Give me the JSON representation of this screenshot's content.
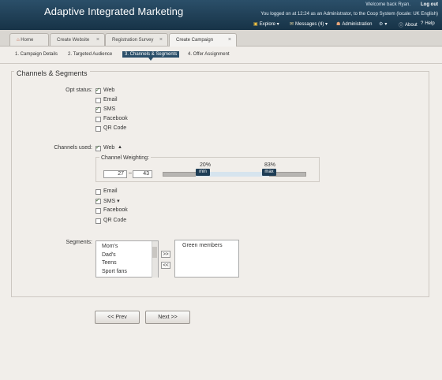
{
  "header": {
    "title": "Adaptive Integrated Marketing",
    "welcome": "Welcome back Ryan.",
    "logout": "Log out",
    "login_info": "You  logged on at 12:24 as an Administrator, to the Coop System (locale: UK English)",
    "menu": {
      "explore": "Explore ▾",
      "messages": "Messages (4) ▾",
      "administration": "Administration",
      "settings": "▾",
      "about": "About",
      "help": "Help"
    }
  },
  "tabs": [
    {
      "label": "Home"
    },
    {
      "label": "Create Website",
      "close": "×"
    },
    {
      "label": "Registration Survey",
      "close": "×"
    },
    {
      "label": "Create Campaign",
      "close": "×"
    }
  ],
  "steps": [
    "1. Campaign Details",
    "2. Targeted Audience",
    "3. Channels & Segments",
    "4. Offer Assignment"
  ],
  "section_title": "Channels & Segments",
  "opt_status": {
    "label": "Opt status:",
    "options": [
      {
        "label": "Web",
        "checked": true
      },
      {
        "label": "Email",
        "checked": false
      },
      {
        "label": "SMS",
        "checked": true
      },
      {
        "label": "Facebook",
        "checked": false
      },
      {
        "label": "QR Code",
        "checked": false
      }
    ]
  },
  "channels_used": {
    "label": "Channels used:",
    "web": {
      "label": "Web",
      "checked": true,
      "toggle": "▲"
    },
    "weighting": {
      "title": "Channel Weighting:",
      "min_value": "27",
      "max_value": "43",
      "separator": "–",
      "min_pct": "20%",
      "max_pct": "83%",
      "min_handle": "min",
      "max_handle": "max"
    },
    "others": [
      {
        "label": "Email",
        "checked": false
      },
      {
        "label": "SMS ▾",
        "checked": true
      },
      {
        "label": "Facebook",
        "checked": false
      },
      {
        "label": "QR Code",
        "checked": false
      }
    ]
  },
  "segments": {
    "label": "Segments:",
    "available": [
      "Mom's",
      "Dad's",
      "Teens",
      "Sport fans"
    ],
    "add": ">>",
    "remove": "<<",
    "selected": [
      "Green members"
    ]
  },
  "buttons": {
    "prev": "<< Prev",
    "next": "Next >>"
  }
}
